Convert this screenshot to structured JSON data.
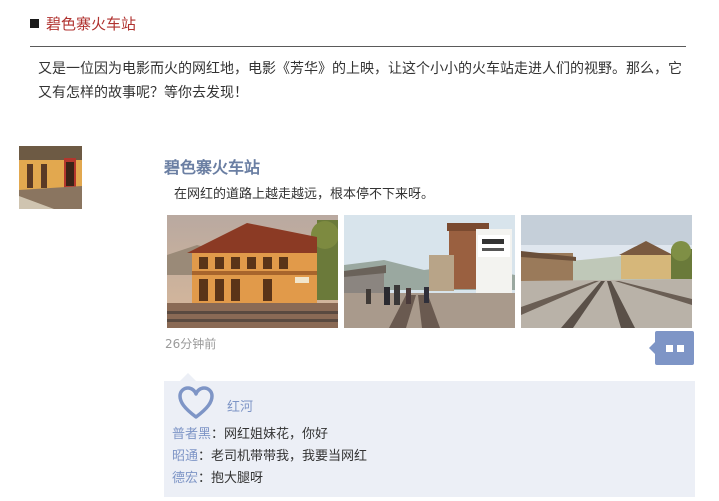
{
  "section": {
    "title": "碧色寨火车站",
    "intro": "又是一位因为电影而火的网红地，电影《芳华》的上映，让这个小小的火车站走进人们的视野。那么，它又有怎样的故事呢？等你去发现！"
  },
  "post": {
    "author": "碧色寨火车站",
    "text": "在网红的道路上越走越远，根本停不下来呀。",
    "time": "26分钟前",
    "icons": {
      "comment": "comment-bubble-icon",
      "like": "heart-icon"
    },
    "colors": {
      "accent": "#7e95c6",
      "title": "#b0322f",
      "feedback_bg": "#eceff6"
    }
  },
  "feedback": {
    "liker": "红河",
    "comments": [
      {
        "who": "普者黑",
        "sep": "：",
        "text": "网红姐妹花，你好"
      },
      {
        "who": "昭通",
        "sep": "：",
        "text": "老司机带带我，我要当网红"
      },
      {
        "who": "德宏",
        "sep": "：",
        "text": "抱大腿呀"
      }
    ]
  },
  "photos": [
    {
      "name": "station-building-photo"
    },
    {
      "name": "platform-crowd-photo"
    },
    {
      "name": "tracks-photo"
    }
  ]
}
